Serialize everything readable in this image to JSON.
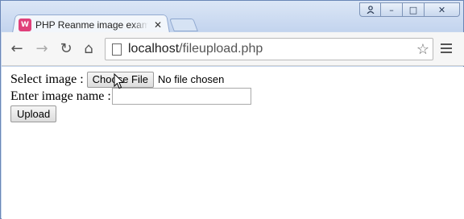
{
  "browser": {
    "tab": {
      "favicon_text": "W",
      "title": "PHP Reanme image example",
      "close_glyph": "✕"
    },
    "window_controls": {
      "user_glyph": "👤",
      "minimize_glyph": "–",
      "maximize_glyph": "□",
      "close_glyph": "✕"
    },
    "nav": {
      "back_glyph": "←",
      "forward_glyph": "→",
      "reload_glyph": "↻",
      "home_glyph": "⌂"
    },
    "address": {
      "host": "localhost",
      "path": "/fileupload.php",
      "star_glyph": "☆"
    }
  },
  "form": {
    "select_label": "Select image :",
    "choose_file_label": "Choose File",
    "file_status": "No file chosen",
    "name_label": "Enter image name :",
    "name_value": "",
    "upload_label": "Upload"
  },
  "colors": {
    "favicon_bg": "#e0407a",
    "window_frame": "#c7d7ee"
  }
}
